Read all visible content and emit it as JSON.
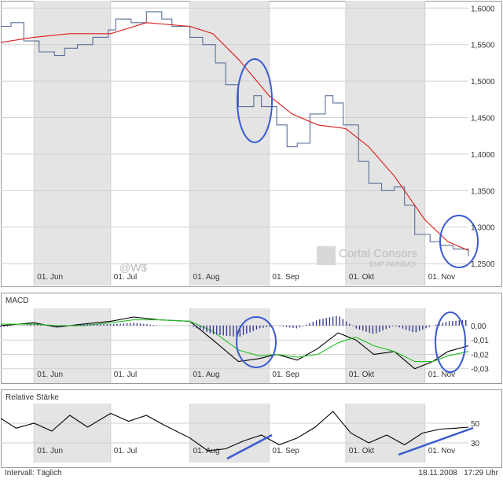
{
  "colors": {
    "price": "#5b6f99",
    "ma": "#dd1a1a",
    "macd_line": "#000000",
    "signal_line": "#22c022",
    "histogram": "#2b2f8f",
    "rsi_line": "#000000",
    "shade": "#e4e4e4",
    "grid": "#d0d0d0",
    "annotation": "#3a5bd0"
  },
  "watermark": {
    "brand": "Cortal Consors",
    "sub": "BNP PARIBAS"
  },
  "footer": {
    "interval": "Intervall: Täglich",
    "date": "18.11.2008",
    "time": "17:29 Uhr"
  },
  "chart_data": [
    {
      "type": "line",
      "title": "",
      "watermark_text": "@W$",
      "x_categories": [
        "01. Jun",
        "01. Jul",
        "01. Aug",
        "01. Sep",
        "01. Okt",
        "01. Nov"
      ],
      "xlim": [
        "2008-05-19",
        "2008-11-18"
      ],
      "ylim": [
        1.22,
        1.61
      ],
      "ytick_labels": [
        "1,2500",
        "1,3000",
        "1,3500",
        "1,4000",
        "1,4500",
        "1,5000",
        "1,5500",
        "1,6000"
      ],
      "yticks": [
        1.25,
        1.3,
        1.35,
        1.4,
        1.45,
        1.5,
        1.55,
        1.6
      ],
      "series": [
        {
          "name": "",
          "style": "step",
          "x": [
            "2008-05-19",
            "2008-05-23",
            "2008-05-28",
            "2008-06-03",
            "2008-06-09",
            "2008-06-13",
            "2008-06-18",
            "2008-06-24",
            "2008-06-30",
            "2008-07-03",
            "2008-07-09",
            "2008-07-15",
            "2008-07-21",
            "2008-07-25",
            "2008-08-01",
            "2008-08-06",
            "2008-08-11",
            "2008-08-15",
            "2008-08-20",
            "2008-08-26",
            "2008-08-29",
            "2008-09-04",
            "2008-09-08",
            "2008-09-12",
            "2008-09-17",
            "2008-09-23",
            "2008-09-26",
            "2008-09-30",
            "2008-10-06",
            "2008-10-10",
            "2008-10-15",
            "2008-10-20",
            "2008-10-24",
            "2008-10-28",
            "2008-11-03",
            "2008-11-07",
            "2008-11-12",
            "2008-11-18"
          ],
          "y": [
            1.575,
            1.58,
            1.555,
            1.54,
            1.535,
            1.545,
            1.55,
            1.56,
            1.57,
            1.585,
            1.58,
            1.595,
            1.585,
            1.575,
            1.56,
            1.55,
            1.525,
            1.495,
            1.465,
            1.48,
            1.465,
            1.44,
            1.41,
            1.415,
            1.455,
            1.48,
            1.47,
            1.44,
            1.39,
            1.36,
            1.35,
            1.355,
            1.33,
            1.29,
            1.28,
            1.275,
            1.27,
            1.26
          ]
        },
        {
          "name": "",
          "style": "line",
          "x": [
            "2008-05-19",
            "2008-06-01",
            "2008-06-15",
            "2008-07-01",
            "2008-07-15",
            "2008-08-01",
            "2008-08-10",
            "2008-08-20",
            "2008-09-01",
            "2008-09-10",
            "2008-09-20",
            "2008-10-01",
            "2008-10-10",
            "2008-10-20",
            "2008-11-01",
            "2008-11-10",
            "2008-11-18"
          ],
          "y": [
            1.553,
            1.56,
            1.565,
            1.565,
            1.58,
            1.575,
            1.565,
            1.53,
            1.48,
            1.455,
            1.44,
            1.435,
            1.41,
            1.37,
            1.31,
            1.28,
            1.268
          ]
        }
      ],
      "grid": true,
      "annotations": [
        "ellipse",
        "ellipse"
      ]
    },
    {
      "type": "line",
      "title": "MACD",
      "x_categories": [
        "01. Jun",
        "01. Jul",
        "01. Aug",
        "01. Sep",
        "01. Okt",
        "01. Nov"
      ],
      "xlim": [
        "2008-05-19",
        "2008-11-18"
      ],
      "ylim": [
        -0.04,
        0.012
      ],
      "ytick_labels": [
        "0,00",
        "-0,01",
        "-0,02",
        "-0,03"
      ],
      "yticks": [
        0.0,
        -0.01,
        -0.02,
        -0.03
      ],
      "series": [
        {
          "name": "",
          "style": "line",
          "x": [
            "2008-05-19",
            "2008-06-01",
            "2008-06-10",
            "2008-06-20",
            "2008-07-01",
            "2008-07-10",
            "2008-07-20",
            "2008-08-01",
            "2008-08-10",
            "2008-08-20",
            "2008-08-28",
            "2008-09-04",
            "2008-09-12",
            "2008-09-20",
            "2008-09-28",
            "2008-10-05",
            "2008-10-12",
            "2008-10-20",
            "2008-10-28",
            "2008-11-04",
            "2008-11-10",
            "2008-11-18"
          ],
          "y": [
            0.0,
            0.002,
            -0.001,
            0.001,
            0.003,
            0.006,
            0.004,
            0.003,
            -0.01,
            -0.025,
            -0.023,
            -0.02,
            -0.024,
            -0.016,
            -0.005,
            -0.01,
            -0.02,
            -0.018,
            -0.03,
            -0.025,
            -0.018,
            -0.014
          ]
        },
        {
          "name": "",
          "style": "line",
          "x": [
            "2008-05-19",
            "2008-06-01",
            "2008-06-10",
            "2008-06-20",
            "2008-07-01",
            "2008-07-10",
            "2008-07-20",
            "2008-08-01",
            "2008-08-10",
            "2008-08-20",
            "2008-08-28",
            "2008-09-04",
            "2008-09-12",
            "2008-09-20",
            "2008-09-28",
            "2008-10-05",
            "2008-10-12",
            "2008-10-20",
            "2008-10-28",
            "2008-11-04",
            "2008-11-10",
            "2008-11-18"
          ],
          "y": [
            0.001,
            0.001,
            0.0,
            0.0,
            0.002,
            0.004,
            0.004,
            0.003,
            -0.004,
            -0.017,
            -0.021,
            -0.02,
            -0.022,
            -0.02,
            -0.012,
            -0.008,
            -0.014,
            -0.018,
            -0.025,
            -0.025,
            -0.021,
            -0.018
          ]
        },
        {
          "name": "",
          "style": "histogram",
          "x": [
            "2008-05-19",
            "2008-06-01",
            "2008-06-10",
            "2008-06-20",
            "2008-07-01",
            "2008-07-10",
            "2008-07-20",
            "2008-08-01",
            "2008-08-10",
            "2008-08-20",
            "2008-08-28",
            "2008-09-04",
            "2008-09-12",
            "2008-09-20",
            "2008-09-28",
            "2008-10-05",
            "2008-10-12",
            "2008-10-20",
            "2008-10-28",
            "2008-11-04",
            "2008-11-10",
            "2008-11-18"
          ],
          "y": [
            -0.001,
            0.001,
            -0.001,
            0.001,
            0.001,
            0.002,
            0.0,
            0.0,
            -0.006,
            -0.008,
            -0.002,
            0.0,
            -0.002,
            0.004,
            0.007,
            -0.002,
            -0.006,
            0.0,
            -0.005,
            0.0,
            0.003,
            0.004
          ]
        }
      ],
      "grid": true,
      "annotations": [
        "ellipse",
        "ellipse"
      ]
    },
    {
      "type": "line",
      "title": "Relative Stärke",
      "x_categories": [
        "01. Jun",
        "01. Jul",
        "01. Aug",
        "01. Sep",
        "01. Okt",
        "01. Nov"
      ],
      "xlim": [
        "2008-05-19",
        "2008-11-18"
      ],
      "ylim": [
        10,
        70
      ],
      "ytick_labels": [
        "50",
        "30"
      ],
      "yticks": [
        50,
        30
      ],
      "series": [
        {
          "name": "",
          "style": "line",
          "x": [
            "2008-05-19",
            "2008-05-25",
            "2008-06-01",
            "2008-06-08",
            "2008-06-15",
            "2008-06-22",
            "2008-07-01",
            "2008-07-08",
            "2008-07-15",
            "2008-07-22",
            "2008-08-01",
            "2008-08-08",
            "2008-08-15",
            "2008-08-22",
            "2008-08-29",
            "2008-09-05",
            "2008-09-12",
            "2008-09-19",
            "2008-09-26",
            "2008-10-03",
            "2008-10-10",
            "2008-10-17",
            "2008-10-24",
            "2008-10-31",
            "2008-11-07",
            "2008-11-13",
            "2008-11-18"
          ],
          "y": [
            55,
            45,
            50,
            42,
            58,
            46,
            60,
            52,
            58,
            48,
            35,
            22,
            24,
            32,
            38,
            28,
            35,
            46,
            62,
            40,
            30,
            38,
            28,
            40,
            44,
            45,
            46
          ]
        }
      ],
      "grid": true,
      "annotations": [
        "trendline",
        "trendline"
      ]
    }
  ]
}
